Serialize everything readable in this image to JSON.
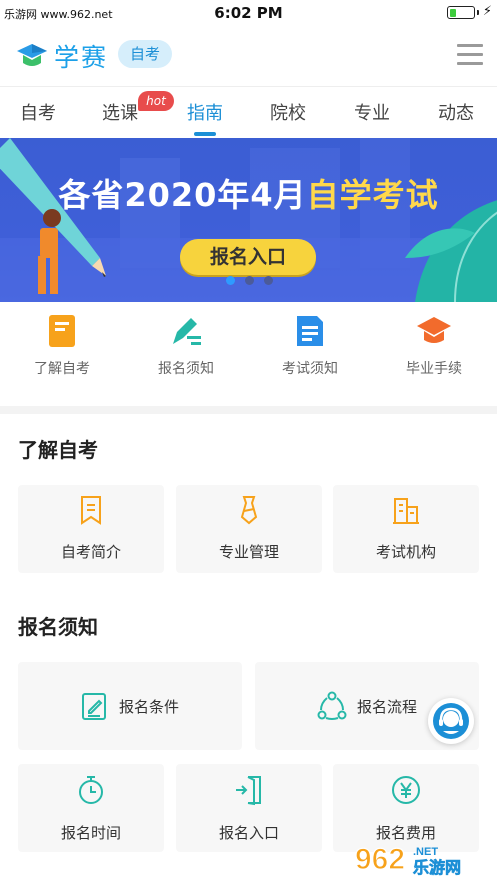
{
  "status_bar": {
    "watermark": "乐游网 www.962.net",
    "time": "6:02 PM",
    "battery_level": 0.3
  },
  "header": {
    "logo_text": "学赛",
    "badge": "自考"
  },
  "tabs": [
    {
      "label": "自考"
    },
    {
      "label": "选课",
      "badge": "hot"
    },
    {
      "label": "指南",
      "active": true
    },
    {
      "label": "院校"
    },
    {
      "label": "专业"
    },
    {
      "label": "动态"
    }
  ],
  "banner": {
    "title_prefix": "各省2020年4月",
    "title_highlight": "自学考试",
    "button": "报名入口",
    "slide_count": 3,
    "active_slide": 0
  },
  "quick_nav": [
    {
      "label": "了解自考",
      "icon": "book-icon",
      "color": "#f7a21b"
    },
    {
      "label": "报名须知",
      "icon": "pen-icon",
      "color": "#26b8a8"
    },
    {
      "label": "考试须知",
      "icon": "document-icon",
      "color": "#2a8ee8"
    },
    {
      "label": "毕业手续",
      "icon": "graduation-cap-icon",
      "color": "#f26b2c"
    }
  ],
  "section_about": {
    "title": "了解自考",
    "items": [
      {
        "label": "自考简介",
        "icon": "bookmark-icon"
      },
      {
        "label": "专业管理",
        "icon": "tie-icon"
      },
      {
        "label": "考试机构",
        "icon": "building-icon"
      }
    ]
  },
  "section_signup": {
    "title": "报名须知",
    "items_top": [
      {
        "label": "报名条件",
        "icon": "edit-icon"
      },
      {
        "label": "报名流程",
        "icon": "flow-icon"
      }
    ],
    "items_bottom": [
      {
        "label": "报名时间",
        "icon": "stopwatch-icon"
      },
      {
        "label": "报名入口",
        "icon": "entrance-icon"
      },
      {
        "label": "报名费用",
        "icon": "yen-icon"
      }
    ]
  },
  "watermark": {
    "number": "962",
    "text": ".NET",
    "cn": "乐游网"
  },
  "colors": {
    "brand": "#1c8fd6",
    "accent_orange": "#f7a21b",
    "accent_teal": "#26b8a8",
    "banner": "#3f5fd8",
    "hot": "#e84c4c"
  }
}
